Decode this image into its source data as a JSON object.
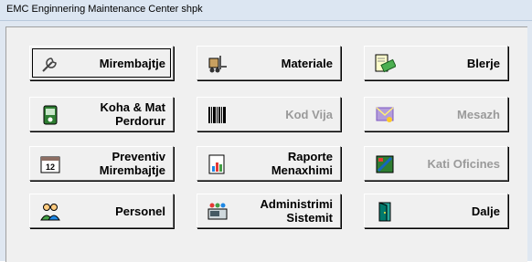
{
  "window": {
    "title": "EMC Enginnering Maintenance Center shpk"
  },
  "buttons": {
    "mirembajtje": "Mirembajtje",
    "materiale": "Materiale",
    "blerje": "Blerje",
    "koha_mat": "Koha & Mat\nPerdorur",
    "kod_vija": "Kod Vija",
    "mesazh": "Mesazh",
    "preventiv": "Preventiv\nMirembajtje",
    "raporte": "Raporte\nMenaxhimi",
    "kati_oficines": "Kati Oficines",
    "personel": "Personel",
    "administrimi": "Administrimi\nSistemit",
    "dalje": "Dalje"
  },
  "icons": {
    "mirembajtje": "wrench-icon",
    "materiale": "forklift-icon",
    "blerje": "invoice-money-icon",
    "koha_mat": "timer-icon",
    "kod_vija": "barcode-icon",
    "mesazh": "message-icon",
    "preventiv": "calendar-icon",
    "raporte": "report-chart-icon",
    "kati_oficines": "office-floor-icon",
    "personel": "people-icon",
    "administrimi": "admin-computer-icon",
    "dalje": "exit-door-icon"
  },
  "state": {
    "disabled": [
      "kod_vija",
      "mesazh",
      "kati_oficines"
    ],
    "focused": "mirembajtje"
  }
}
